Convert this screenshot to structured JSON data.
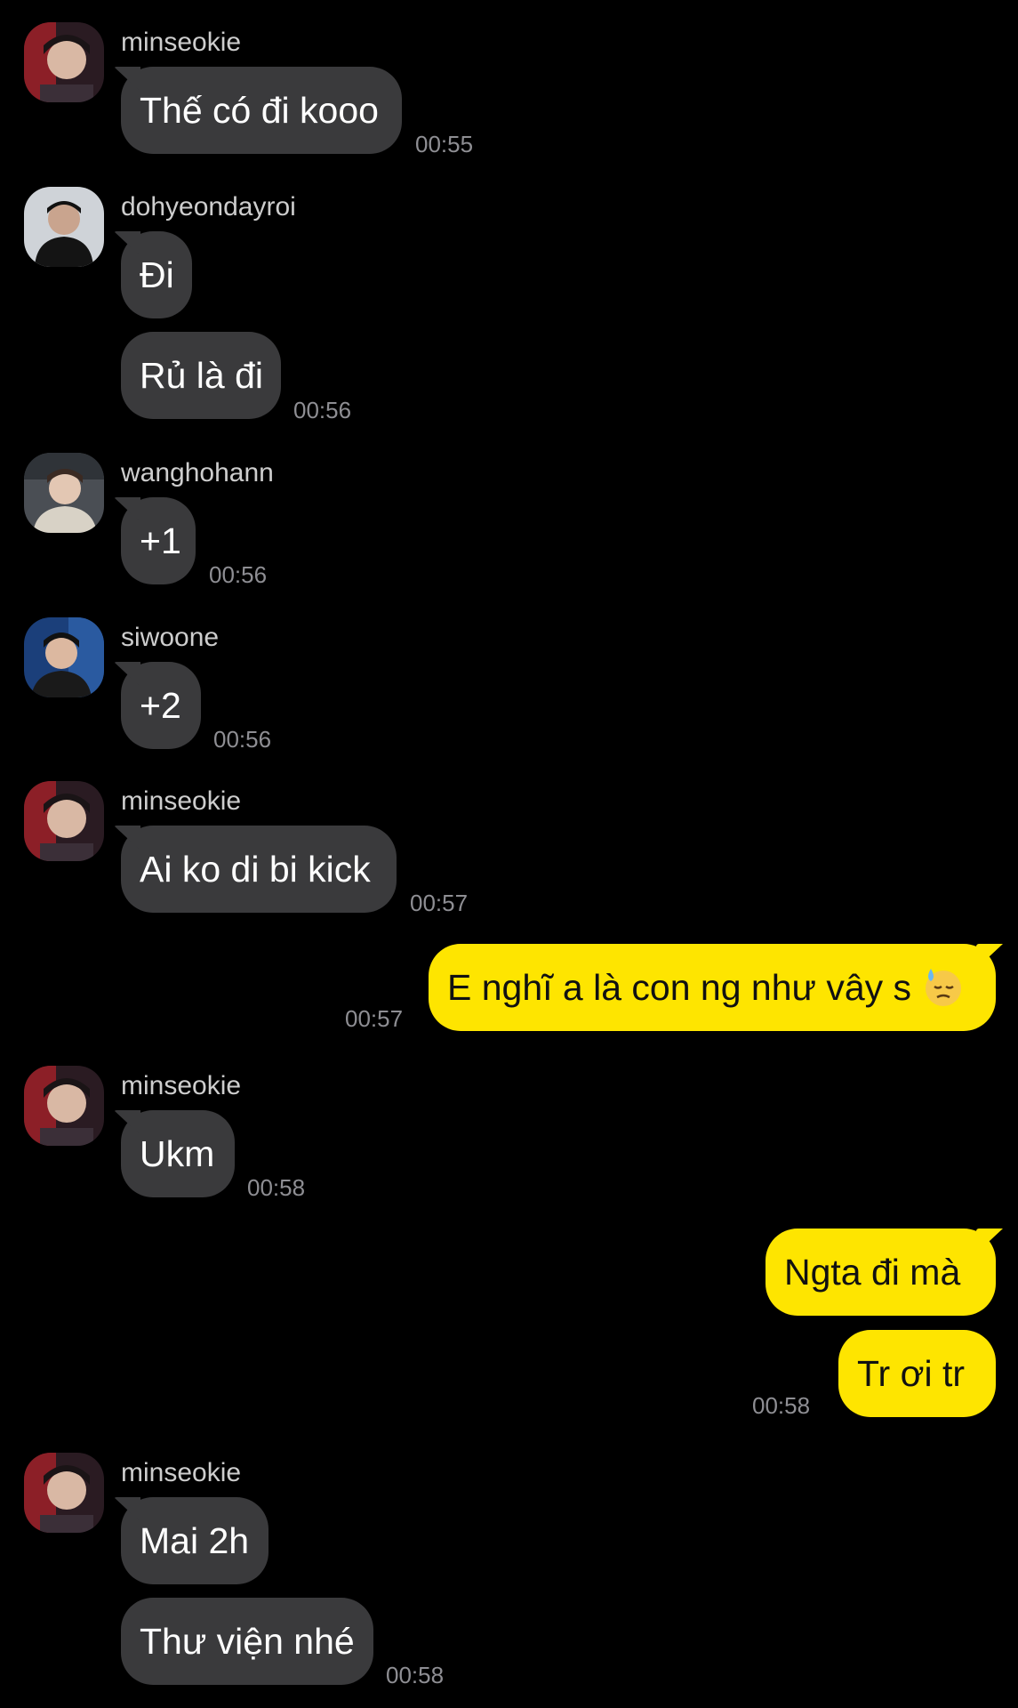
{
  "messages": [
    {
      "sender": "minseokie",
      "text": "Thế có đi kooo",
      "time": "00:55"
    },
    {
      "sender": "dohyeondayroi",
      "text": "Đi"
    },
    {
      "text": "Rủ là đi",
      "time": "00:56"
    },
    {
      "sender": "wanghohann",
      "text": "+1",
      "time": "00:56"
    },
    {
      "sender": "siwoone",
      "text": "+2",
      "time": "00:56"
    },
    {
      "sender": "minseokie",
      "text": "Ai ko di bi kick",
      "time": "00:57"
    },
    {
      "text": "E nghĩ a là con ng như vây s",
      "time": "00:57",
      "emoji": "downcast-face-with-sweat-icon"
    },
    {
      "sender": "minseokie",
      "text": "Ukm",
      "time": "00:58"
    },
    {
      "text": "Ngta đi mà"
    },
    {
      "text": "Tr ơi tr",
      "time": "00:58"
    },
    {
      "sender": "minseokie",
      "text": "Mai 2h"
    },
    {
      "text": "Thư viện nhé",
      "time": "00:58"
    }
  ],
  "colors": {
    "background": "#000000",
    "incoming_bubble": "#3a3a3c",
    "outgoing_bubble": "#fee500",
    "timestamp": "#8e8e93",
    "sender_name": "#cdcdcd"
  }
}
